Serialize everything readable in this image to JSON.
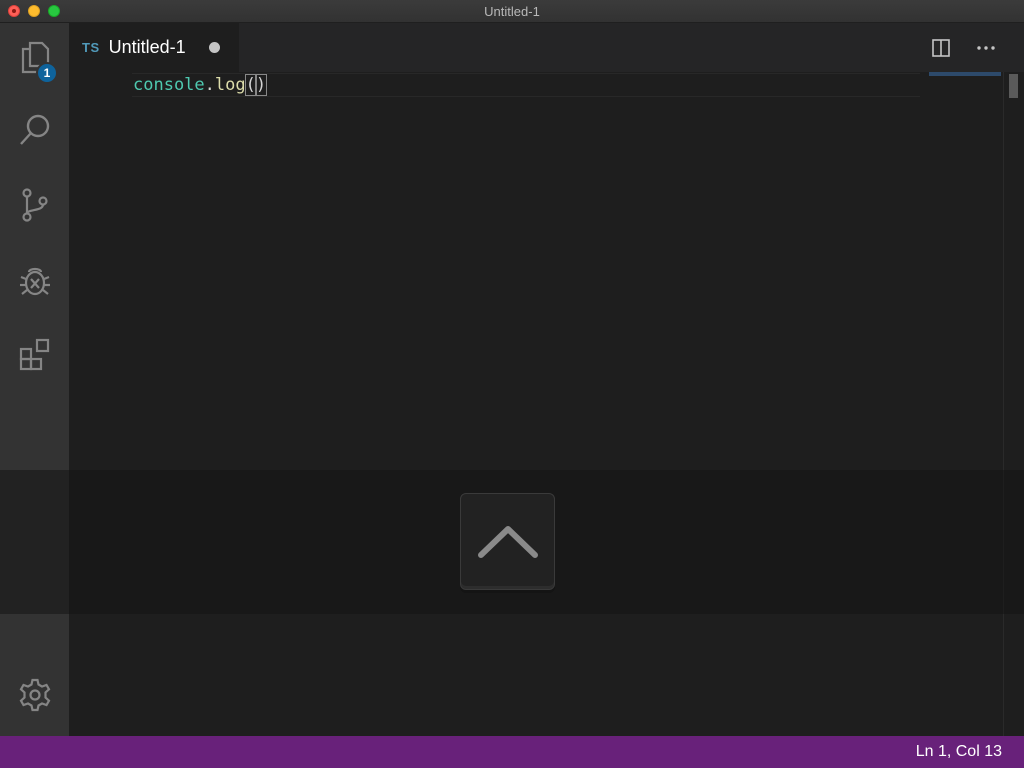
{
  "window": {
    "title": "Untitled-1"
  },
  "activity_bar": {
    "explorer": {
      "icon": "files-icon",
      "badge": "1"
    },
    "search": {
      "icon": "search-icon"
    },
    "source_control": {
      "icon": "source-control-icon"
    },
    "debug": {
      "icon": "debug-icon"
    },
    "extensions": {
      "icon": "extensions-icon"
    },
    "settings": {
      "icon": "gear-icon"
    }
  },
  "tab": {
    "language": "TS",
    "label": "Untitled-1",
    "dirty": true
  },
  "editor_actions": {
    "split": {
      "icon": "split-editor-icon"
    },
    "more": {
      "icon": "more-actions-icon"
    }
  },
  "editor": {
    "line1": {
      "object": "console",
      "dot": ".",
      "method": "log",
      "open_paren": "(",
      "close_paren": ")"
    }
  },
  "key_overlay": {
    "key": "up-caret-icon"
  },
  "status_bar": {
    "position": "Ln 1, Col 13",
    "color": "#68217a"
  }
}
